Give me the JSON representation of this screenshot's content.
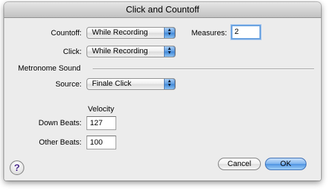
{
  "dialog": {
    "title": "Click and Countoff"
  },
  "countoff": {
    "label": "Countoff:",
    "value": "While Recording"
  },
  "measures": {
    "label": "Measures:",
    "value": "2"
  },
  "click": {
    "label": "Click:",
    "value": "While Recording"
  },
  "metronome": {
    "section_title": "Metronome Sound",
    "source_label": "Source:",
    "source_value": "Finale Click",
    "velocity_header": "Velocity",
    "down_beats_label": "Down Beats:",
    "down_beats_value": "127",
    "other_beats_label": "Other Beats:",
    "other_beats_value": "100"
  },
  "buttons": {
    "help": "?",
    "cancel": "Cancel",
    "ok": "OK"
  },
  "icons": {
    "popup_arrows": "up-down-arrows-icon",
    "help": "help-icon"
  },
  "colors": {
    "accent_blue": "#5e9ee3",
    "focus_ring": "#6aa2e0",
    "window_bg": "#ececec"
  }
}
